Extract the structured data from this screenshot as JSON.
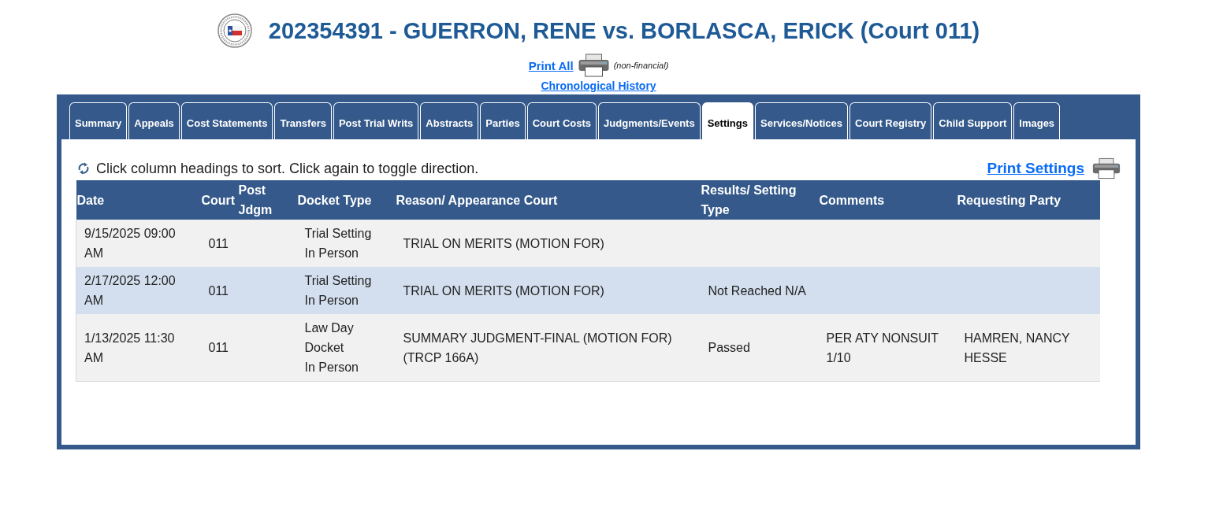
{
  "header": {
    "title": "202354391 - GUERRON, RENE vs. BORLASCA, ERICK (Court 011)",
    "print_all": {
      "label": "Print All",
      "note": "(non-financial)"
    },
    "chronological_history": "Chronological History"
  },
  "tabs": [
    {
      "label": "Summary",
      "selected": false
    },
    {
      "label": "Appeals",
      "selected": false
    },
    {
      "label": "Cost Statements",
      "selected": false
    },
    {
      "label": "Transfers",
      "selected": false
    },
    {
      "label": "Post Trial Writs",
      "selected": false
    },
    {
      "label": "Abstracts",
      "selected": false
    },
    {
      "label": "Parties",
      "selected": false
    },
    {
      "label": "Court Costs",
      "selected": false
    },
    {
      "label": "Judgments/Events",
      "selected": false
    },
    {
      "label": "Settings",
      "selected": true
    },
    {
      "label": "Services/Notices",
      "selected": false
    },
    {
      "label": "Court Registry",
      "selected": false
    },
    {
      "label": "Child Support",
      "selected": false
    },
    {
      "label": "Images",
      "selected": false
    }
  ],
  "panel": {
    "sort_hint": "Click column headings to sort. Click again to toggle direction.",
    "print_link": "Print Settings",
    "table": {
      "columns": [
        "Date",
        "Court",
        "Post Jdgm",
        "Docket Type",
        "Reason/ Appearance Court",
        "Results/ Setting Type",
        "Comments",
        "Requesting Party"
      ],
      "rows": [
        {
          "date": "9/15/2025 09:00 AM",
          "court": "011",
          "docket_type": [
            "Trial Setting",
            "In Person"
          ],
          "reason": "TRIAL ON MERITS (MOTION FOR)"
        },
        {
          "date": "2/17/2025 12:00 AM",
          "court": "011",
          "docket_type": [
            "Trial Setting",
            "In Person"
          ],
          "reason": "TRIAL ON MERITS (MOTION FOR)",
          "results": "Not Reached N/A"
        },
        {
          "date": "1/13/2025 11:30 AM",
          "court": "011",
          "docket_type": [
            "Law Day",
            "Docket",
            "In Person"
          ],
          "reason": "SUMMARY JUDGMENT-FINAL (MOTION FOR) (TRCP 166A)",
          "results": "Passed",
          "comments": "PER ATY NONSUIT 1/10",
          "requesting_party": "HAMREN, NANCY HESSE"
        }
      ]
    }
  }
}
